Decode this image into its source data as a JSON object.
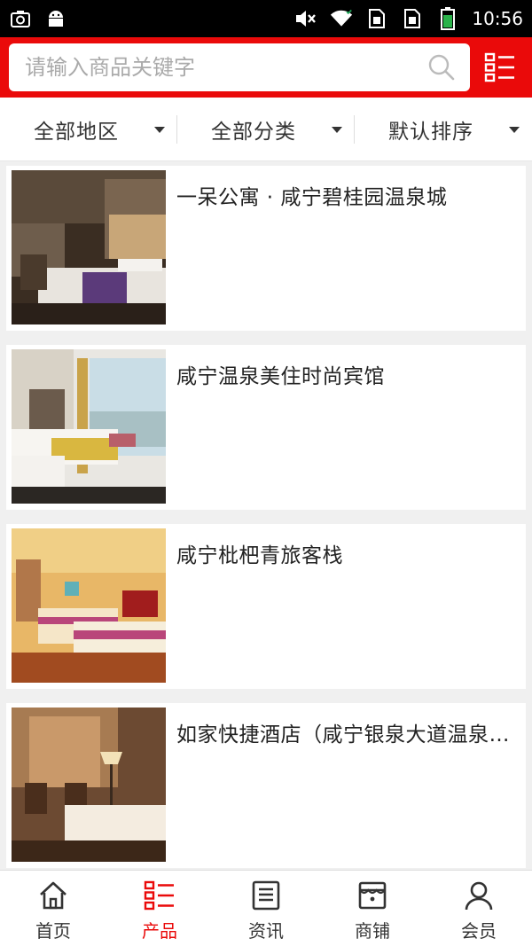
{
  "statusbar": {
    "time": "10:56",
    "icons": [
      "screenshot-icon",
      "android-icon",
      "mute-icon",
      "wifi-icon",
      "sim1-icon",
      "sim2-icon",
      "battery-icon"
    ]
  },
  "header": {
    "search_placeholder": "请输入商品关键字",
    "search_value": "",
    "menu_icon": "list-menu-icon",
    "accent_color": "#ea0a0a"
  },
  "filters": [
    {
      "label": "全部地区"
    },
    {
      "label": "全部分类"
    },
    {
      "label": "默认排序"
    }
  ],
  "products": [
    {
      "title": "一呆公寓 · 咸宁碧桂园温泉城",
      "image": "hotel-room-dark-photo"
    },
    {
      "title": "咸宁温泉美住时尚宾馆",
      "image": "hotel-room-balcony-photo"
    },
    {
      "title": "咸宁枇杷青旅客栈",
      "image": "hotel-room-twin-beds-photo"
    },
    {
      "title": "如家快捷酒店（咸宁银泉大道温泉中心店）",
      "image": "hotel-room-lamp-photo"
    }
  ],
  "tabbar": {
    "items": [
      {
        "label": "首页",
        "icon": "home-icon"
      },
      {
        "label": "产品",
        "icon": "products-icon"
      },
      {
        "label": "资讯",
        "icon": "news-icon"
      },
      {
        "label": "商铺",
        "icon": "shop-icon"
      },
      {
        "label": "会员",
        "icon": "member-icon"
      }
    ],
    "active_index": 1
  }
}
